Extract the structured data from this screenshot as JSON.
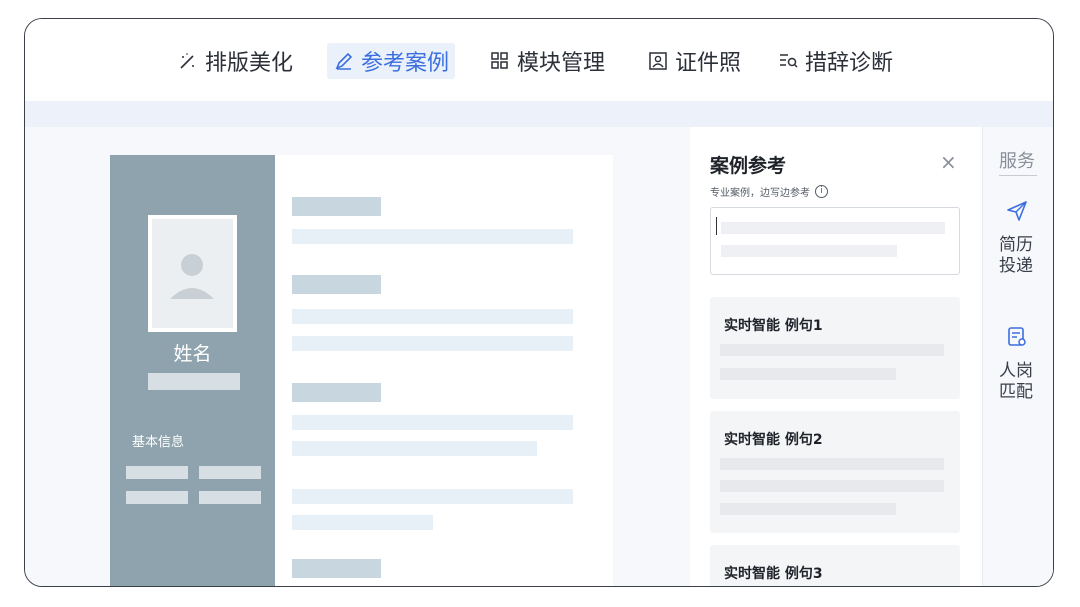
{
  "toolbar": {
    "items": [
      {
        "label": "排版美化",
        "icon": "magic-wand-icon",
        "active": false
      },
      {
        "label": "参考案例",
        "icon": "pen-icon",
        "active": true
      },
      {
        "label": "模块管理",
        "icon": "grid-icon",
        "active": false
      },
      {
        "label": "证件照",
        "icon": "id-photo-icon",
        "active": false
      },
      {
        "label": "措辞诊断",
        "icon": "diagnose-icon",
        "active": false
      }
    ]
  },
  "resume": {
    "name": "姓名",
    "section_label": "基本信息"
  },
  "panel": {
    "title": "案例参考",
    "close": "×",
    "subtitle": "专业案例，边写边参考",
    "info": "i",
    "cases": [
      {
        "title": "实时智能 例句1"
      },
      {
        "title": "实时智能 例句2"
      },
      {
        "title": "实时智能 例句3"
      }
    ]
  },
  "rail": {
    "title": "服务",
    "items": [
      {
        "label_line1": "简历",
        "label_line2": "投递",
        "icon": "send-icon"
      },
      {
        "label_line1": "人岗",
        "label_line2": "匹配",
        "icon": "match-doc-icon"
      }
    ]
  },
  "colors": {
    "accent": "#3b6fe0",
    "resume_sidebar": "#8ea3ae",
    "band": "#edf2fa"
  }
}
